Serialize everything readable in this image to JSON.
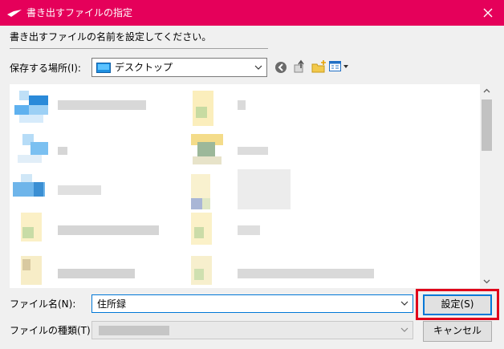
{
  "window": {
    "title": "書き出すファイルの指定",
    "accent": "#e5005a"
  },
  "prompt": "書き出すファイルの名前を設定してください。",
  "save_location": {
    "label": "保存する場所(I):",
    "value": "デスクトップ",
    "icon": "desktop-icon"
  },
  "toolbar": [
    "back-icon",
    "up-folder-icon",
    "new-folder-icon",
    "view-menu-icon"
  ],
  "file_name": {
    "label": "ファイル名(N):",
    "value": "住所録"
  },
  "file_type": {
    "label": "ファイルの種類(T):",
    "value": ""
  },
  "buttons": {
    "ok": "設定(S)",
    "cancel": "キャンセル"
  },
  "highlight_color": "#e0001b"
}
